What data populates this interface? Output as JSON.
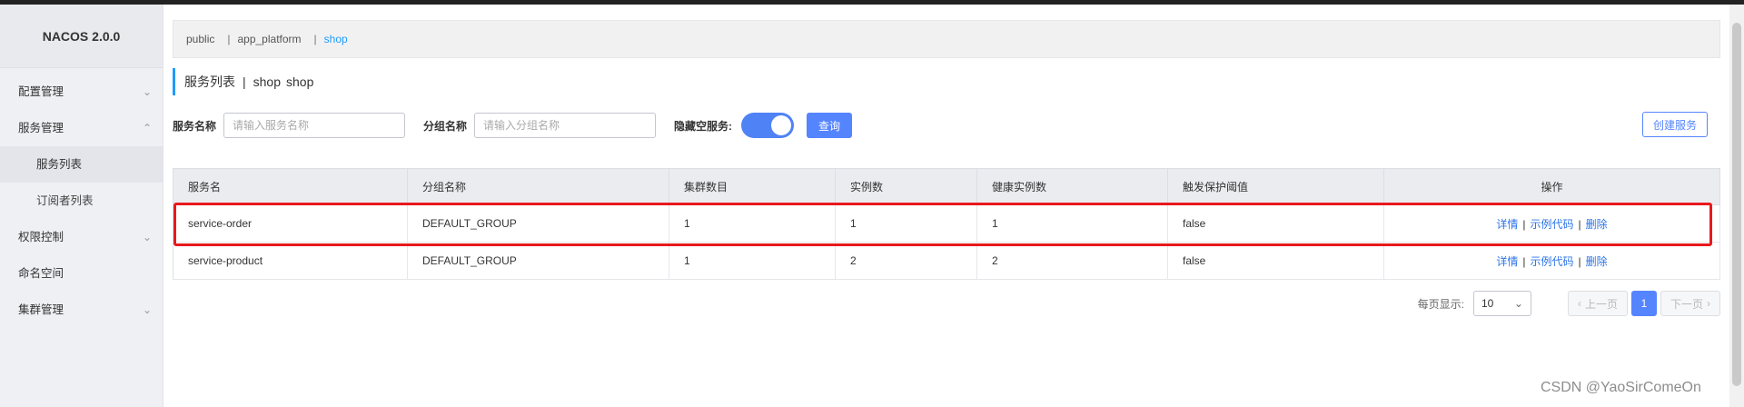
{
  "brand": "NACOS 2.0.0",
  "sidebar": {
    "items": [
      {
        "label": "配置管理",
        "chevron": "⌄"
      },
      {
        "label": "服务管理",
        "chevron": "⌃"
      },
      {
        "label": "服务列表"
      },
      {
        "label": "订阅者列表"
      },
      {
        "label": "权限控制",
        "chevron": "⌄"
      },
      {
        "label": "命名空间"
      },
      {
        "label": "集群管理",
        "chevron": "⌄"
      }
    ]
  },
  "namespaces": [
    "public",
    "app_platform",
    "shop"
  ],
  "page": {
    "title": "服务列表",
    "separator": "|",
    "ns_name": "shop",
    "ns_id": "shop"
  },
  "filters": {
    "service_label": "服务名称",
    "service_placeholder": "请输入服务名称",
    "group_label": "分组名称",
    "group_placeholder": "请输入分组名称",
    "hide_empty_label": "隐藏空服务:",
    "query_button": "查询",
    "create_button": "创建服务"
  },
  "table": {
    "headers": [
      "服务名",
      "分组名称",
      "集群数目",
      "实例数",
      "健康实例数",
      "触发保护阈值",
      "操作"
    ],
    "rows": [
      [
        "service-order",
        "DEFAULT_GROUP",
        "1",
        "1",
        "1",
        "false"
      ],
      [
        "service-product",
        "DEFAULT_GROUP",
        "1",
        "2",
        "2",
        "false"
      ]
    ],
    "actions": {
      "detail": "详情",
      "sample": "示例代码",
      "delete": "删除",
      "sep": "|"
    }
  },
  "pagination": {
    "per_page_label": "每页显示:",
    "per_page_value": "10",
    "prev": "上一页",
    "next": "下一页",
    "current_page": "1"
  },
  "watermark": "CSDN @YaoSirComeOn"
}
